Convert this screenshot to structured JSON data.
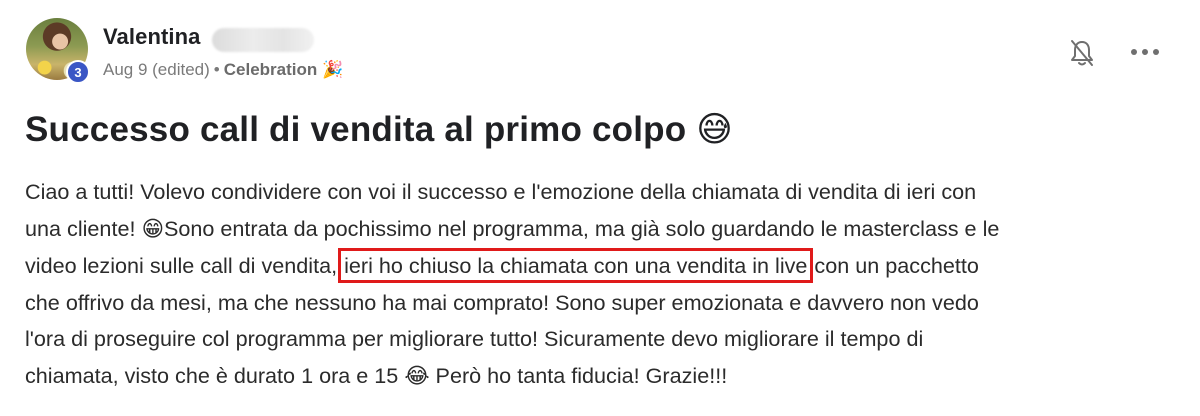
{
  "post": {
    "author": {
      "name": "Valentina",
      "level": "3"
    },
    "meta": {
      "date": "Aug 9 (edited)",
      "separator": "•",
      "category": "Celebration",
      "category_emoji": "🎉"
    },
    "title": "Successo call di vendita al primo colpo",
    "title_emoji": "😅",
    "body": {
      "line1": "Ciao a tutti! Volevo condividere con voi il successo e l'emozione della chiamata di vendita di ieri con",
      "line2_start": "una cliente! ",
      "line2_emoji": "😁",
      "line2_end": "Sono entrata da pochissimo nel programma, ma già solo guardando le masterclass e le",
      "line3_start": "video lezioni sulle call di vendita, ",
      "line3_highlight": "ieri ho chiuso la chiamata con una vendita in live",
      "line3_end": " con un pacchetto",
      "line4": "che offrivo da mesi, ma che nessuno ha mai comprato! Sono super emozionata e davvero non vedo",
      "line5": "l'ora di proseguire col programma per migliorare tutto! Sicuramente devo migliorare il tempo di",
      "line6_start": "chiamata, visto che è durato 1 ora e 15 ",
      "line6_emoji": "😂",
      "line6_end": " Però ho tanta fiducia! Grazie!!!"
    },
    "actions": {
      "notification_icon": "bell-slash-icon",
      "more_icon": "more-horizontal-icon"
    },
    "colors": {
      "highlight_border": "#e01a1a",
      "level_badge": "#3a56c5"
    }
  }
}
